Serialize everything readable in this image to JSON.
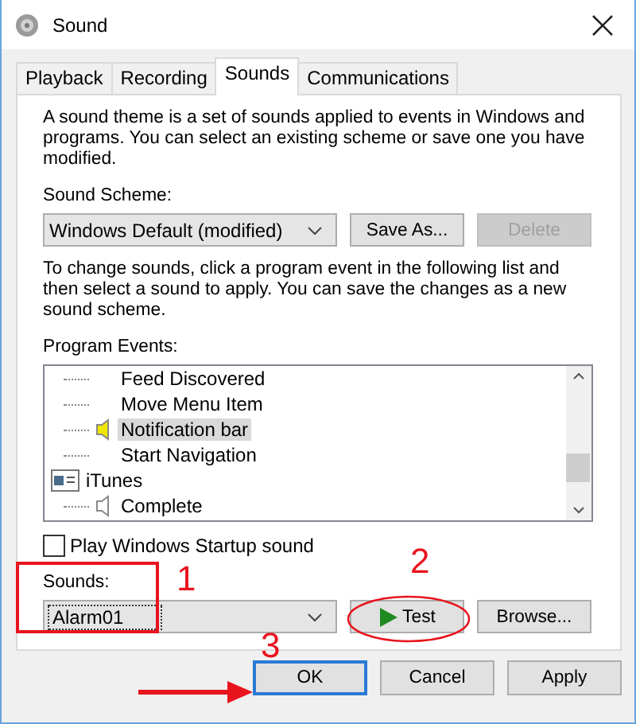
{
  "window": {
    "title": "Sound"
  },
  "tabs": [
    {
      "label": "Playback",
      "selected": false
    },
    {
      "label": "Recording",
      "selected": false
    },
    {
      "label": "Sounds",
      "selected": true
    },
    {
      "label": "Communications",
      "selected": false
    }
  ],
  "intro": "A sound theme is a set of sounds applied to events in Windows and programs.  You can select an existing scheme or save one you have modified.",
  "scheme": {
    "label": "Sound Scheme:",
    "value": "Windows Default (modified)",
    "buttons": [
      {
        "label": "Save As...",
        "disabled": false
      },
      {
        "label": "Delete",
        "disabled": true
      }
    ]
  },
  "help": "To change sounds, click a program event in the following list and then select a sound to apply.  You can save the changes as a new sound scheme.",
  "events_label": "Program Events:",
  "events": [
    {
      "children": [
        {
          "label": "Feed Discovered",
          "has_sound": false,
          "selected": false
        },
        {
          "label": "Move Menu Item",
          "has_sound": false,
          "selected": false
        },
        {
          "label": "Notification bar",
          "has_sound": true,
          "selected": true
        },
        {
          "label": "Start Navigation",
          "has_sound": false,
          "selected": false
        }
      ]
    },
    {
      "label": "iTunes",
      "children": [
        {
          "label": "Complete",
          "has_sound": true,
          "selected": false
        }
      ]
    }
  ],
  "startup": {
    "label": "Play Windows Startup sound",
    "checked": false
  },
  "sounds": {
    "label": "Sounds:",
    "value": "Alarm01",
    "buttons": [
      {
        "label": "Test",
        "kind": "play"
      },
      {
        "label": "Browse...",
        "kind": "plain"
      }
    ]
  },
  "footer": [
    {
      "label": "OK",
      "default": true
    },
    {
      "label": "Cancel",
      "default": false
    },
    {
      "label": "Apply",
      "default": false
    }
  ],
  "annotations": [
    {
      "kind": "box",
      "number": "1"
    },
    {
      "kind": "ellipse",
      "number": "2"
    },
    {
      "kind": "arrow",
      "number": "3"
    }
  ]
}
